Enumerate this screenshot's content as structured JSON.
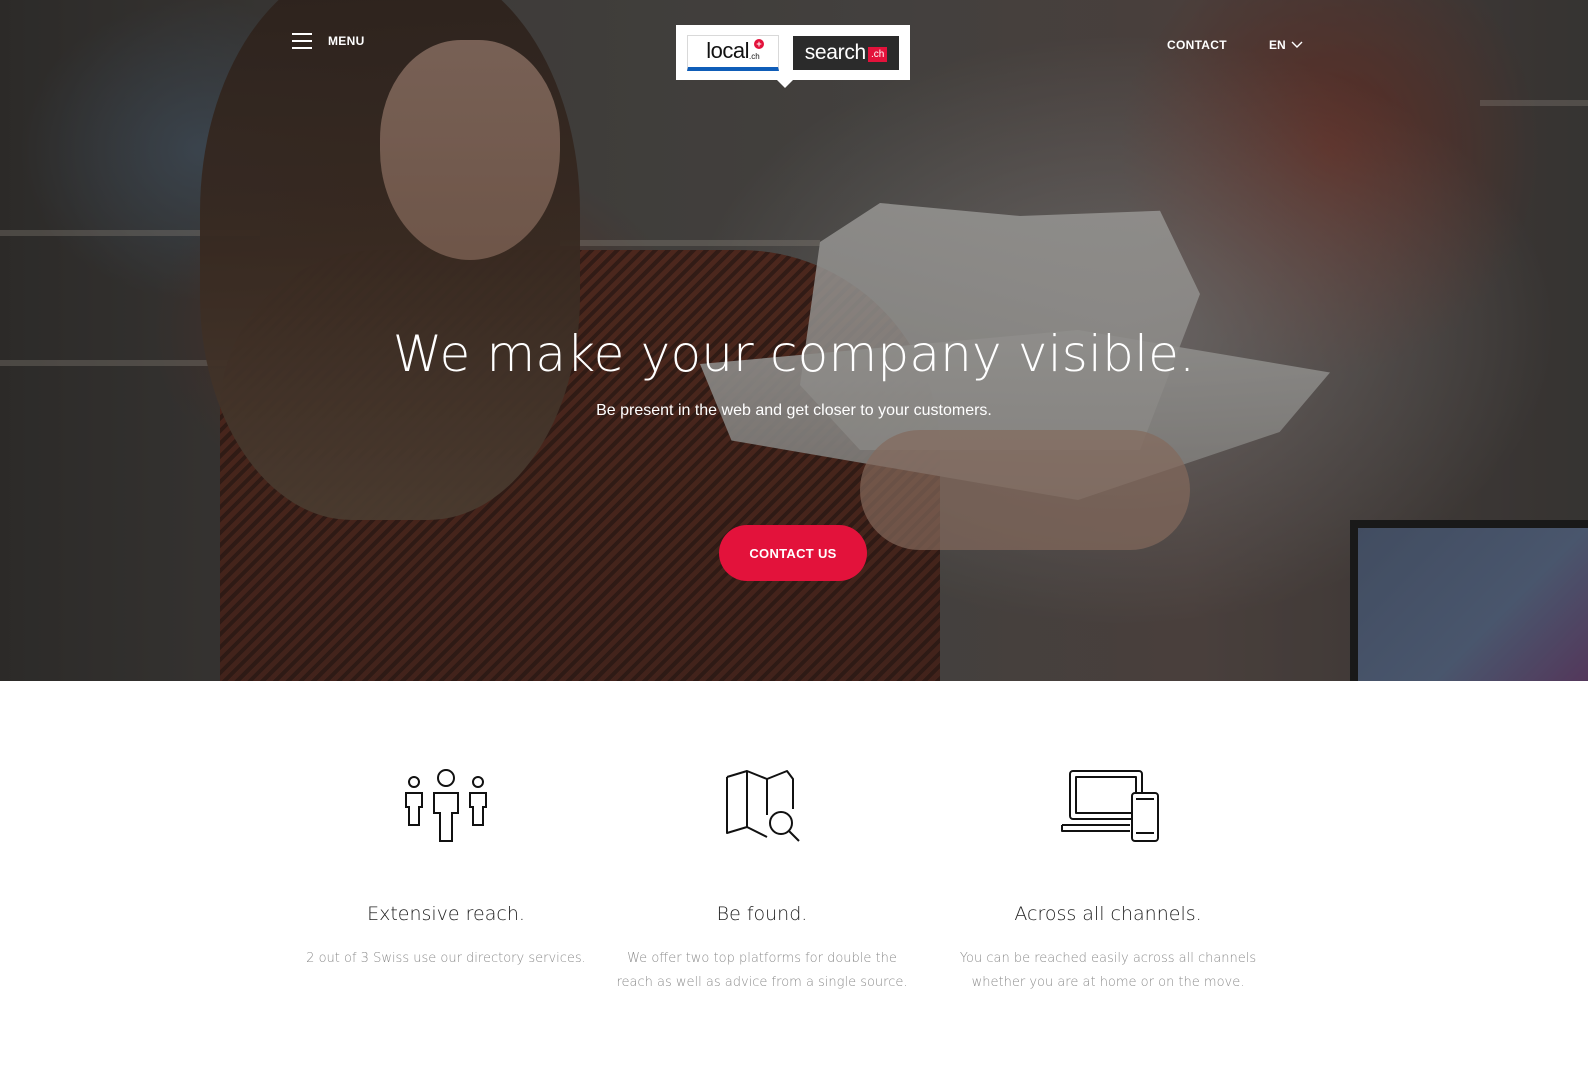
{
  "nav": {
    "menu_label": "MENU",
    "contact_label": "CONTACT",
    "language": "EN"
  },
  "logo": {
    "local_text": "local",
    "local_suffix": ".ch",
    "search_text": "search",
    "search_suffix": ".ch"
  },
  "hero": {
    "title": "We make your company visible.",
    "subtitle": "Be present in the web and get closer to your customers.",
    "cta_label": "CONTACT US"
  },
  "features": [
    {
      "icon": "people-icon",
      "title": "Extensive reach.",
      "description": "2 out of 3 Swiss use our directory services."
    },
    {
      "icon": "map-search-icon",
      "title": "Be found.",
      "description": "We offer two top platforms for double the reach as well as advice from a single source."
    },
    {
      "icon": "devices-icon",
      "title": "Across all channels.",
      "description": "You can be reached easily across all channels whether you are at home or on the move."
    }
  ],
  "colors": {
    "accent": "#e3123b",
    "brand_blue": "#0f5db8",
    "text_dark": "#222222",
    "text_muted": "#8c8c8c"
  }
}
